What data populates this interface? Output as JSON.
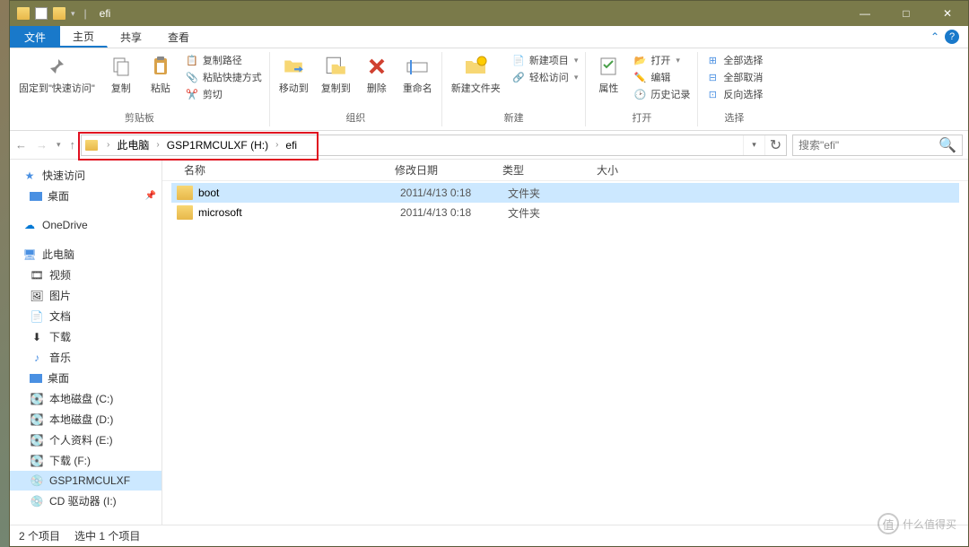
{
  "titlebar": {
    "title": "efi"
  },
  "win_controls": {
    "min": "—",
    "max": "□",
    "close": "✕"
  },
  "tabs": {
    "file": "文件",
    "home": "主页",
    "share": "共享",
    "view": "查看"
  },
  "ribbon": {
    "clipboard": {
      "pin": "固定到\"快速访问\"",
      "copy": "复制",
      "paste": "粘贴",
      "copy_path": "复制路径",
      "paste_shortcut": "粘贴快捷方式",
      "cut": "剪切",
      "label": "剪贴板"
    },
    "organize": {
      "move_to": "移动到",
      "copy_to": "复制到",
      "delete": "删除",
      "rename": "重命名",
      "label": "组织"
    },
    "new": {
      "new_folder": "新建文件夹",
      "new_item": "新建项目",
      "easy_access": "轻松访问",
      "label": "新建"
    },
    "open": {
      "properties": "属性",
      "open": "打开",
      "edit": "编辑",
      "history": "历史记录",
      "label": "打开"
    },
    "select": {
      "select_all": "全部选择",
      "select_none": "全部取消",
      "invert": "反向选择",
      "label": "选择"
    }
  },
  "breadcrumb": {
    "items": [
      "此电脑",
      "GSP1RMCULXF (H:)",
      "efi"
    ]
  },
  "search": {
    "placeholder": "搜索\"efi\""
  },
  "sidebar": {
    "quick_access": "快速访问",
    "desktop": "桌面",
    "onedrive": "OneDrive",
    "this_pc": "此电脑",
    "videos": "视频",
    "pictures": "图片",
    "documents": "文档",
    "downloads": "下载",
    "music": "音乐",
    "desktop2": "桌面",
    "disk_c": "本地磁盘 (C:)",
    "disk_d": "本地磁盘 (D:)",
    "disk_e": "个人资料 (E:)",
    "disk_f": "下载 (F:)",
    "drive_h": "GSP1RMCULXF",
    "cd_drive": "CD 驱动器 (I:)"
  },
  "columns": {
    "name": "名称",
    "date": "修改日期",
    "type": "类型",
    "size": "大小"
  },
  "files": [
    {
      "name": "boot",
      "date": "2011/4/13 0:18",
      "type": "文件夹",
      "selected": true
    },
    {
      "name": "microsoft",
      "date": "2011/4/13 0:18",
      "type": "文件夹",
      "selected": false
    }
  ],
  "statusbar": {
    "count": "2 个项目",
    "selected": "选中 1 个项目"
  },
  "watermark": {
    "text": "什么值得买",
    "badge": "值"
  }
}
